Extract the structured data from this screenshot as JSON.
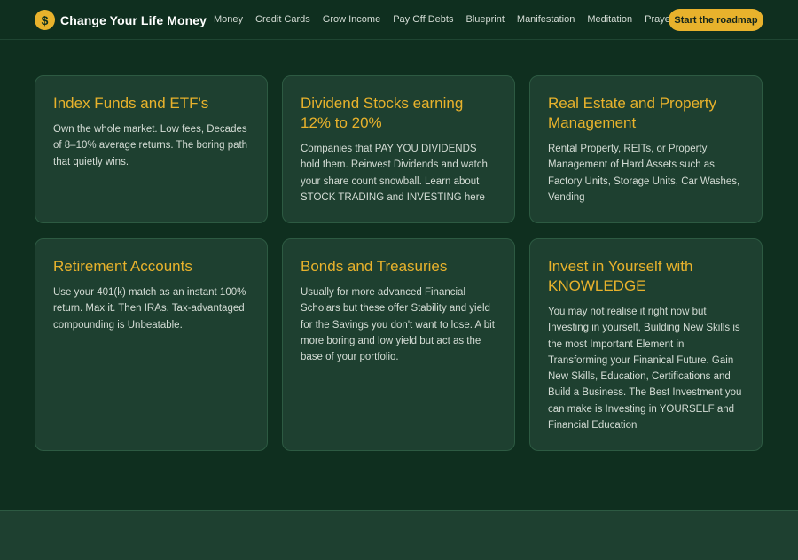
{
  "header": {
    "brand_icon": "$",
    "brand_name": "Change Your Life Money",
    "nav": [
      "Money",
      "Credit Cards",
      "Grow Income",
      "Pay Off Debts",
      "Blueprint",
      "Manifestation",
      "Meditation",
      "Prayers"
    ],
    "cta_label": "Start the roadmap"
  },
  "colors": {
    "background": "#0f2f1f",
    "card": "#1e4030",
    "accent": "#e8b22c",
    "text": "#d4dcd5"
  },
  "cards": [
    {
      "title": "Index Funds and ETF's",
      "body": "Own the whole market. Low fees, Decades of 8–10% average returns. The boring path that quietly wins."
    },
    {
      "title": "Dividend Stocks earning 12% to 20%",
      "body": "Companies that PAY YOU DIVIDENDS hold them. Reinvest Dividends and watch your share count snowball. Learn about STOCK TRADING and INVESTING here"
    },
    {
      "title": "Real Estate and Property Management",
      "body": "Rental Property, REITs, or Property Management of Hard Assets such as Factory Units, Storage Units, Car Washes, Vending"
    },
    {
      "title": "Retirement Accounts",
      "body": "Use your 401(k) match as an instant 100% return. Max it. Then IRAs. Tax-advantaged compounding is Unbeatable."
    },
    {
      "title": "Bonds and Treasuries",
      "body": "Usually for more advanced Financial Scholars but these offer Stability and yield for the Savings you don't want to lose. A bit more boring and low yield but act as the base of your portfolio."
    },
    {
      "title": " Invest in Yourself with KNOWLEDGE",
      "body": "You may not realise it right now but Investing in yourself, Building New Skills is the most Important Element in Transforming your Finanical Future. Gain New Skills, Education, Certifications and Build a Business. The Best Investment you can make is Investing in YOURSELF and Financial Education"
    }
  ]
}
